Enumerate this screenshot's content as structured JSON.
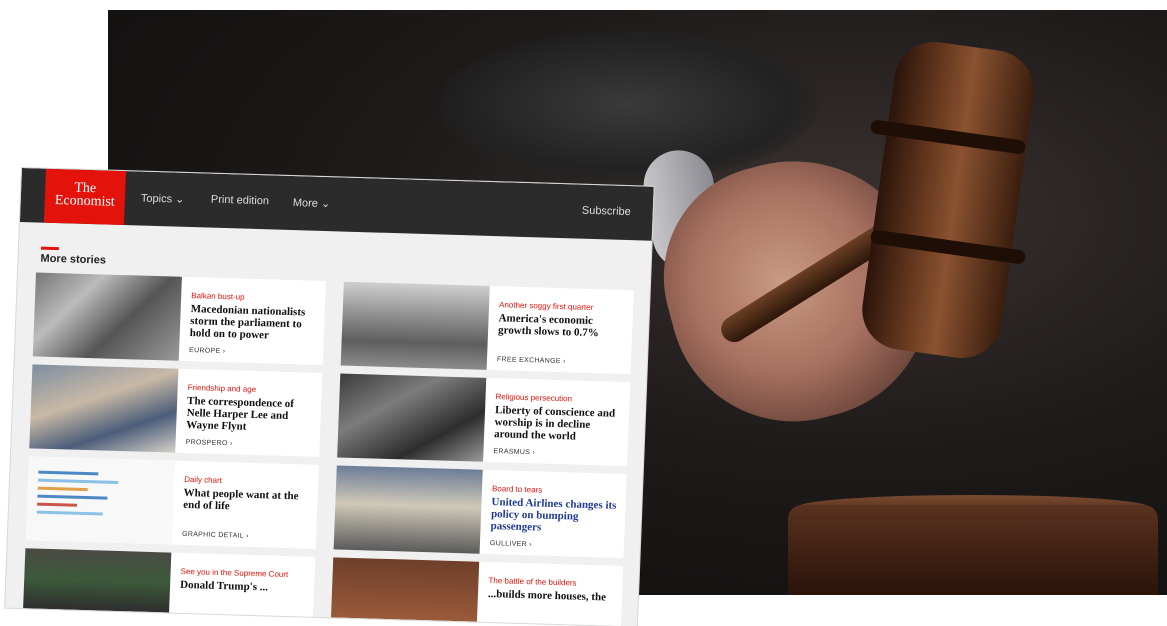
{
  "site": {
    "logo": "The Economist",
    "nav": {
      "topics": "Topics ⌄",
      "print": "Print edition",
      "more": "More ⌄",
      "subscribe": "Subscribe"
    },
    "section_title": "More stories"
  },
  "stories": [
    {
      "kicker": "Balkan bust-up",
      "headline": "Macedonian nationalists storm the parliament to hold on to power",
      "section": "EUROPE ›"
    },
    {
      "kicker": "Friendship and age",
      "headline": "The correspondence of Nelle Harper Lee and Wayne Flynt",
      "section": "PROSPERO ›"
    },
    {
      "kicker": "Daily chart",
      "headline": "What people want at the end of life",
      "section": "GRAPHIC DETAIL ›"
    },
    {
      "kicker": "See you in the Supreme Court",
      "headline": "Donald Trump's ...",
      "section": ""
    },
    {
      "kicker": "Another soggy first quarter",
      "headline": "America's economic growth slows to 0.7%",
      "section": "FREE EXCHANGE ›"
    },
    {
      "kicker": "Religious persecution",
      "headline": "Liberty of conscience and worship is in decline around the world",
      "section": "ERASMUS ›"
    },
    {
      "kicker": "Board to tears",
      "headline": "United Airlines changes its policy on bumping passengers",
      "section": "GULLIVER ›"
    },
    {
      "kicker": "The battle of the builders",
      "headline": "...builds more houses, the",
      "section": ""
    }
  ],
  "colors": {
    "brand_red": "#e3120b",
    "nav_bg": "#2b2b2b",
    "link_blue": "#1f3a93"
  }
}
